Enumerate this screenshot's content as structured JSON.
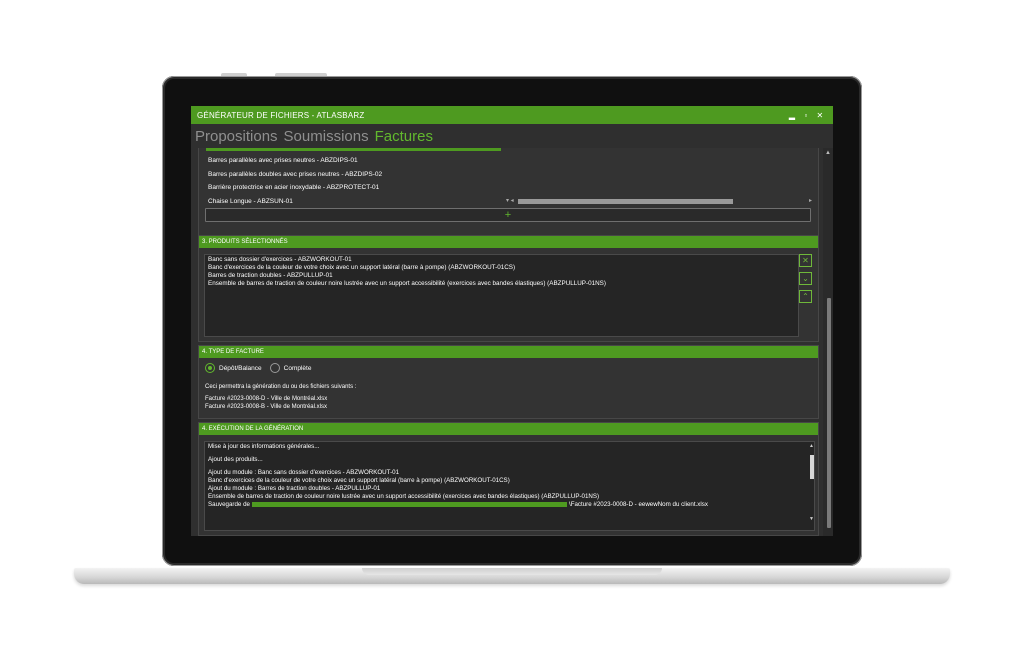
{
  "window": {
    "title": "GÉNÉRATEUR DE FICHIERS - ATLASBARZ",
    "minimize_icon": "minimize-icon",
    "maximize_icon": "maximize-icon",
    "close_icon": "close-icon"
  },
  "tabs": [
    {
      "label": "Propositions",
      "active": false
    },
    {
      "label": "Soumissions",
      "active": false
    },
    {
      "label": "Factures",
      "active": true
    }
  ],
  "colors": {
    "accent": "#4e9a20",
    "accent_light": "#62b82e",
    "background": "#2f2f2f"
  },
  "product_list": {
    "items": [
      "Barres parallèles avec prises neutres - ABZDIPS-01",
      "Barres parallèles doubles avec prises neutres - ABZDIPS-02",
      "Barrière protectrice en acier inoxydable - ABZPROTECT-01",
      "Chaise Longue - ABZSUN-01"
    ],
    "add_label": "+"
  },
  "selected_products": {
    "header": "3. PRODUITS SÉLECTIONNÉS",
    "items": [
      "Banc sans dossier d'exercices - ABZWORKOUT-01",
      "Banc d'exercices de la couleur de votre choix avec un support latéral (barre à pompe) (ABZWORKOUT-01CS)",
      "Barres de traction doubles - ABZPULLUP-01",
      "Ensemble de barres de traction de couleur noire lustrée avec un support accessibilité (exercices avec bandes élastiques) (ABZPULLUP-01NS)"
    ],
    "buttons": [
      "✕",
      "⌄",
      "⌃"
    ]
  },
  "invoice_type": {
    "header": "4. TYPE DE FACTURE",
    "option_deposit": "Dépôt/Balance",
    "option_complete": "Complète",
    "selected": "Dépôt/Balance",
    "note": "Ceci permettra la génération du ou des fichiers suivants :",
    "files": [
      "Facture #2023-0008-D - Ville de Montréal.xlsx",
      "Facture #2023-0008-B - Ville de Montréal.xlsx"
    ]
  },
  "execution": {
    "header": "4. EXÉCUTION DE LA GÉNÉRATION",
    "line1": "Mise à jour des informations générales...",
    "line2": "Ajout des produits...",
    "line3": "Ajout du module : Banc sans dossier d'exercices - ABZWORKOUT-01",
    "line4": "Banc d'exercices de la couleur de votre choix avec un support latéral (barre à pompe) (ABZWORKOUT-01CS)",
    "line5": "Ajout du module : Barres de traction doubles - ABZPULLUP-01",
    "line6": "Ensemble de barres de traction de couleur noire lustrée avec un support accessibilité (exercices avec bandes élastiques) (ABZPULLUP-01NS)",
    "save_prefix": "Sauvegarde de",
    "save_suffix": "\\Facture #2023-0008-D - eewewNom du client.xlsx"
  }
}
